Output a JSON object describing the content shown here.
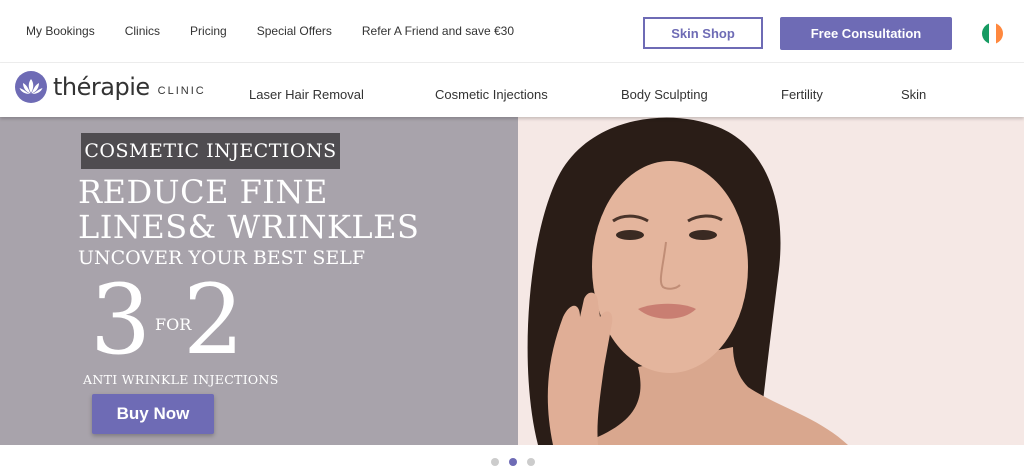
{
  "top_nav": {
    "links": [
      "My Bookings",
      "Clinics",
      "Pricing",
      "Special Offers",
      "Refer A Friend and save €30"
    ],
    "skin_shop": "Skin Shop",
    "free_consultation": "Free Consultation",
    "flag_colors": [
      "#169b62",
      "#ffffff",
      "#ff883e"
    ]
  },
  "brand": {
    "name": "thérapie",
    "sub": "CLINIC",
    "accent": "#6e6bb5"
  },
  "main_nav": {
    "items": [
      "Laser Hair Removal",
      "Cosmetic Injections",
      "Body Sculpting",
      "Fertility",
      "Skin"
    ]
  },
  "hero": {
    "badge": "COSMETIC INJECTIONS",
    "headline_line1": "REDUCE FINE",
    "headline_line2": "LINES& WRINKLES",
    "subheadline": "UNCOVER YOUR BEST SELF",
    "offer_number_a": "3",
    "offer_for": "FOR",
    "offer_number_b": "2",
    "offer_caption": "ANTI WRINKLE INJECTIONS",
    "cta": "Buy Now"
  },
  "carousel": {
    "active_index": 1,
    "count": 3
  }
}
